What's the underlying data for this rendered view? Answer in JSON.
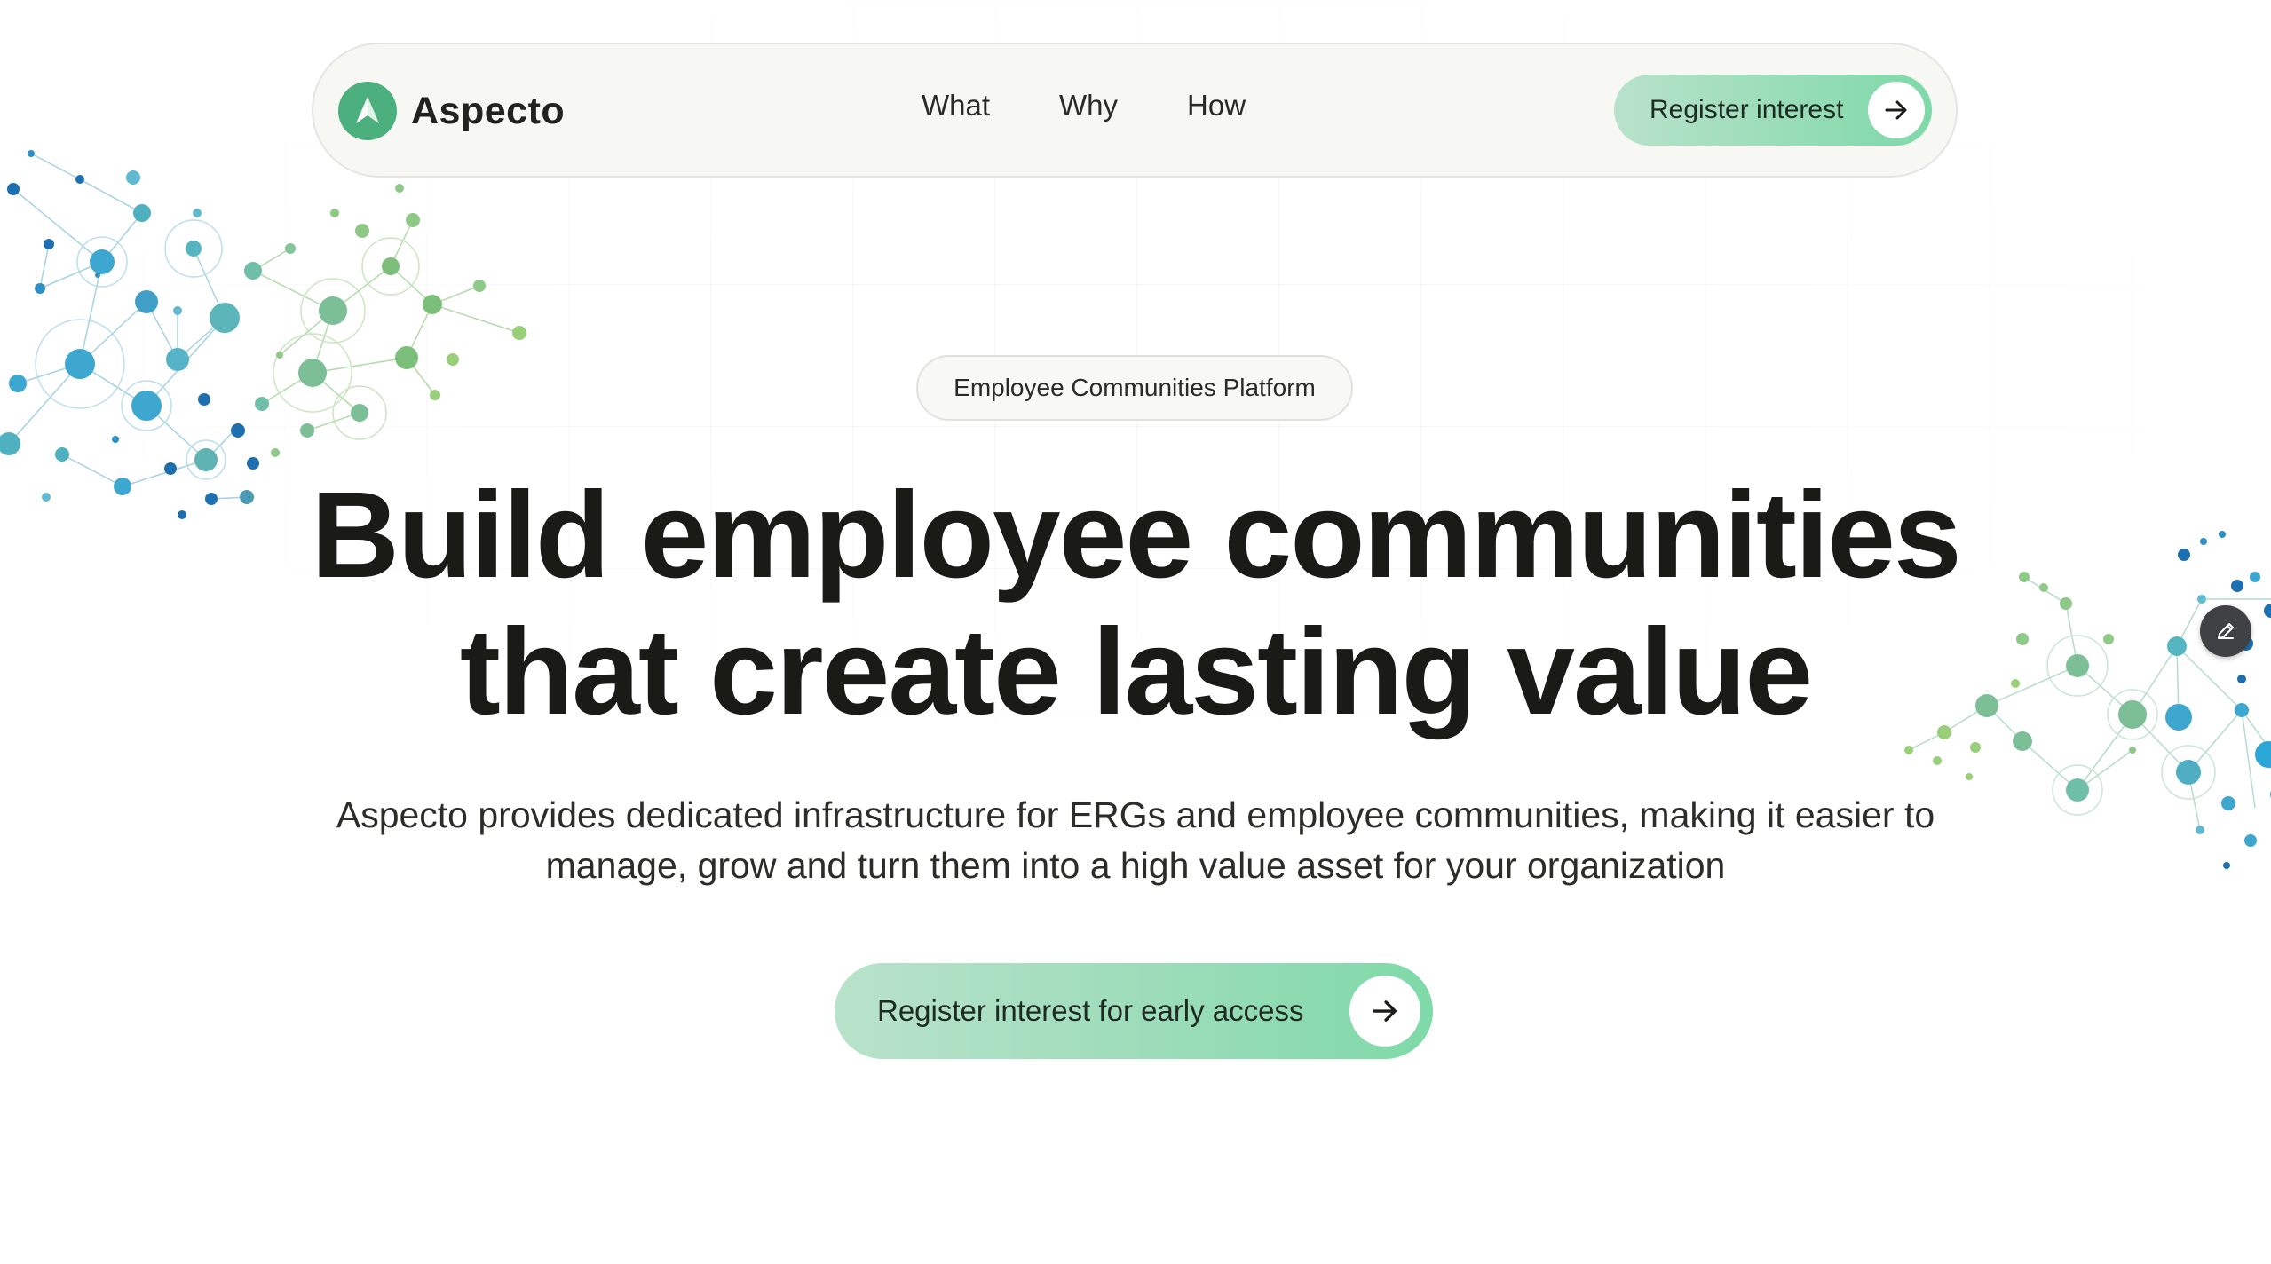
{
  "brand": {
    "name": "Aspecto",
    "logo_icon": "arrow-navigation-icon",
    "logo_color": "#4caf7e"
  },
  "nav": {
    "links": [
      {
        "label": "What"
      },
      {
        "label": "Why"
      },
      {
        "label": "How"
      }
    ],
    "cta_label": "Register interest",
    "cta_icon": "arrow-right-icon"
  },
  "hero": {
    "badge": "Employee Communities Platform",
    "headline_line1": "Build employee communities",
    "headline_line2": "that create lasting value",
    "subtitle_line1": "Aspecto provides dedicated infrastructure for ERGs and employee communities, making it easier to",
    "subtitle_line2": "manage, grow and turn them into a high value asset for your organization",
    "cta_label": "Register interest for early access",
    "cta_icon": "arrow-right-icon"
  },
  "edit_button_icon": "pencil-icon",
  "colors": {
    "accent_green": "#7fd9a8",
    "accent_green_light": "#b9e2cb",
    "network_blue": "#2d8fc4",
    "network_teal": "#4fb1c0",
    "network_green": "#7cbf7a",
    "text_dark": "#1a1b17"
  }
}
